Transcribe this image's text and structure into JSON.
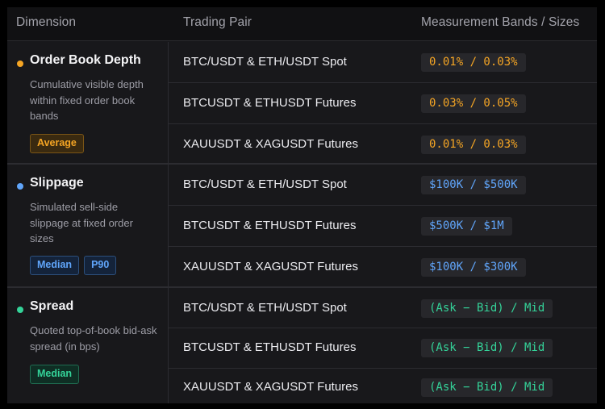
{
  "header": {
    "col1": "Dimension",
    "col2": "Trading Pair",
    "col3": "Measurement Bands / Sizes"
  },
  "colors": {
    "orange": "#f5a524",
    "blue": "#60a5fa",
    "green": "#34d399"
  },
  "groups": [
    {
      "title": "Order Book Depth",
      "desc": "Cumulative visible depth within fixed order book bands",
      "color": "#f5a524",
      "icon": "orange-dot-icon",
      "badges": [
        "Average"
      ],
      "rows": [
        {
          "pair": "BTC/USDT & ETH/USDT Spot",
          "band": "0.01% / 0.03%"
        },
        {
          "pair": "BTCUSDT & ETHUSDT Futures",
          "band": "0.03% / 0.05%"
        },
        {
          "pair": "XAUUSDT & XAGUSDT Futures",
          "band": "0.01% / 0.03%"
        }
      ]
    },
    {
      "title": "Slippage",
      "desc": "Simulated sell-side slippage at fixed order sizes",
      "color": "#60a5fa",
      "icon": "blue-dot-icon",
      "badges": [
        "Median",
        "P90"
      ],
      "rows": [
        {
          "pair": "BTC/USDT & ETH/USDT Spot",
          "band": "$100K / $500K"
        },
        {
          "pair": "BTCUSDT & ETHUSDT Futures",
          "band": "$500K / $1M"
        },
        {
          "pair": "XAUUSDT & XAGUSDT Futures",
          "band": "$100K / $300K"
        }
      ]
    },
    {
      "title": "Spread",
      "desc": "Quoted top-of-book bid-ask spread (in bps)",
      "color": "#34d399",
      "icon": "green-dot-icon",
      "badges": [
        "Median"
      ],
      "rows": [
        {
          "pair": "BTC/USDT & ETH/USDT Spot",
          "band": "(Ask − Bid) / Mid"
        },
        {
          "pair": "BTCUSDT & ETHUSDT Futures",
          "band": "(Ask − Bid) / Mid"
        },
        {
          "pair": "XAUUSDT & XAGUSDT Futures",
          "band": "(Ask − Bid) / Mid"
        }
      ]
    }
  ]
}
